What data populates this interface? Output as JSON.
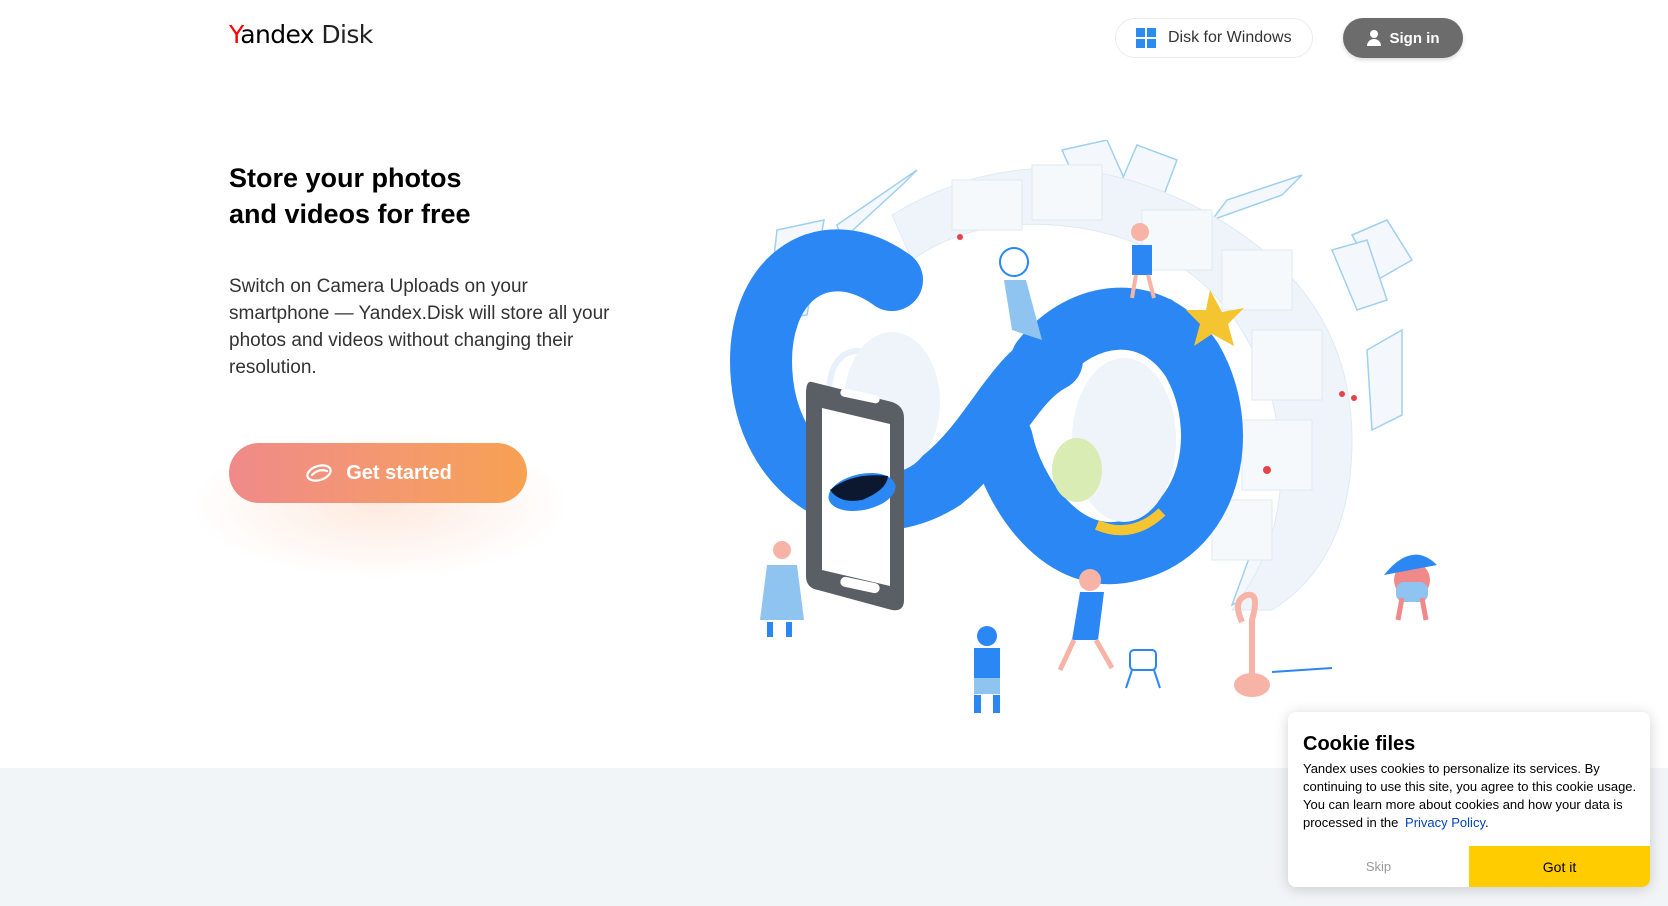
{
  "header": {
    "logo_brand": "Yandex",
    "logo_product": "Disk",
    "windows_button_label": "Disk for Windows",
    "windows_icon": "windows-logo-icon",
    "signin_button_label": "Sign in",
    "signin_icon": "user-icon"
  },
  "hero": {
    "title_line1": "Store your photos",
    "title_line2": "and videos for free",
    "description": "Switch on Camera Uploads on your smartphone — Yandex.Disk will store all your photos and videos without changing their resolution.",
    "cta_label": "Get started",
    "cta_icon": "disk-logo-icon"
  },
  "cookie": {
    "title": "Cookie files",
    "text": "Yandex uses cookies to personalize its services. By continuing to use this site, you agree to this cookie usage. You can learn more about cookies and how your data is processed in the",
    "link_label": "Privacy Policy",
    "link_suffix": ".",
    "skip_label": "Skip",
    "accept_label": "Got it"
  },
  "colors": {
    "brand_red": "#ff0000",
    "infinity_blue": "#2a87f3",
    "cta_gradient_start": "#f08a8a",
    "cta_gradient_end": "#f7a152",
    "signin_bg": "#6c6c6c",
    "accept_yellow": "#ffcc00",
    "band_bg": "#f2f5f8"
  }
}
